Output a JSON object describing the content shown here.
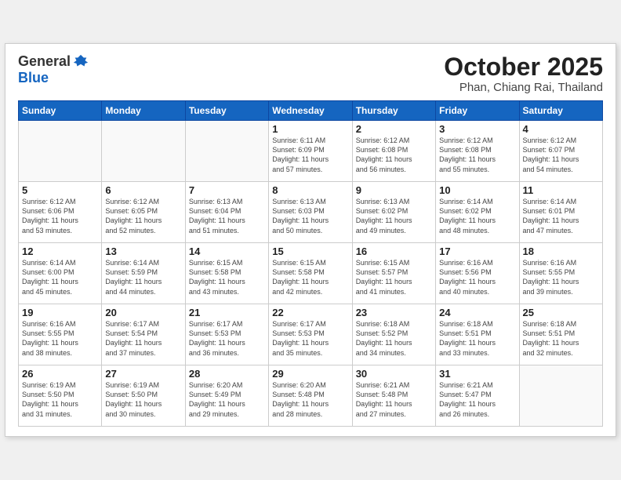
{
  "header": {
    "logo_line1": "General",
    "logo_line2": "Blue",
    "month": "October 2025",
    "location": "Phan, Chiang Rai, Thailand"
  },
  "days_of_week": [
    "Sunday",
    "Monday",
    "Tuesday",
    "Wednesday",
    "Thursday",
    "Friday",
    "Saturday"
  ],
  "weeks": [
    [
      {
        "day": "",
        "info": ""
      },
      {
        "day": "",
        "info": ""
      },
      {
        "day": "",
        "info": ""
      },
      {
        "day": "1",
        "info": "Sunrise: 6:11 AM\nSunset: 6:09 PM\nDaylight: 11 hours\nand 57 minutes."
      },
      {
        "day": "2",
        "info": "Sunrise: 6:12 AM\nSunset: 6:08 PM\nDaylight: 11 hours\nand 56 minutes."
      },
      {
        "day": "3",
        "info": "Sunrise: 6:12 AM\nSunset: 6:08 PM\nDaylight: 11 hours\nand 55 minutes."
      },
      {
        "day": "4",
        "info": "Sunrise: 6:12 AM\nSunset: 6:07 PM\nDaylight: 11 hours\nand 54 minutes."
      }
    ],
    [
      {
        "day": "5",
        "info": "Sunrise: 6:12 AM\nSunset: 6:06 PM\nDaylight: 11 hours\nand 53 minutes."
      },
      {
        "day": "6",
        "info": "Sunrise: 6:12 AM\nSunset: 6:05 PM\nDaylight: 11 hours\nand 52 minutes."
      },
      {
        "day": "7",
        "info": "Sunrise: 6:13 AM\nSunset: 6:04 PM\nDaylight: 11 hours\nand 51 minutes."
      },
      {
        "day": "8",
        "info": "Sunrise: 6:13 AM\nSunset: 6:03 PM\nDaylight: 11 hours\nand 50 minutes."
      },
      {
        "day": "9",
        "info": "Sunrise: 6:13 AM\nSunset: 6:02 PM\nDaylight: 11 hours\nand 49 minutes."
      },
      {
        "day": "10",
        "info": "Sunrise: 6:14 AM\nSunset: 6:02 PM\nDaylight: 11 hours\nand 48 minutes."
      },
      {
        "day": "11",
        "info": "Sunrise: 6:14 AM\nSunset: 6:01 PM\nDaylight: 11 hours\nand 47 minutes."
      }
    ],
    [
      {
        "day": "12",
        "info": "Sunrise: 6:14 AM\nSunset: 6:00 PM\nDaylight: 11 hours\nand 45 minutes."
      },
      {
        "day": "13",
        "info": "Sunrise: 6:14 AM\nSunset: 5:59 PM\nDaylight: 11 hours\nand 44 minutes."
      },
      {
        "day": "14",
        "info": "Sunrise: 6:15 AM\nSunset: 5:58 PM\nDaylight: 11 hours\nand 43 minutes."
      },
      {
        "day": "15",
        "info": "Sunrise: 6:15 AM\nSunset: 5:58 PM\nDaylight: 11 hours\nand 42 minutes."
      },
      {
        "day": "16",
        "info": "Sunrise: 6:15 AM\nSunset: 5:57 PM\nDaylight: 11 hours\nand 41 minutes."
      },
      {
        "day": "17",
        "info": "Sunrise: 6:16 AM\nSunset: 5:56 PM\nDaylight: 11 hours\nand 40 minutes."
      },
      {
        "day": "18",
        "info": "Sunrise: 6:16 AM\nSunset: 5:55 PM\nDaylight: 11 hours\nand 39 minutes."
      }
    ],
    [
      {
        "day": "19",
        "info": "Sunrise: 6:16 AM\nSunset: 5:55 PM\nDaylight: 11 hours\nand 38 minutes."
      },
      {
        "day": "20",
        "info": "Sunrise: 6:17 AM\nSunset: 5:54 PM\nDaylight: 11 hours\nand 37 minutes."
      },
      {
        "day": "21",
        "info": "Sunrise: 6:17 AM\nSunset: 5:53 PM\nDaylight: 11 hours\nand 36 minutes."
      },
      {
        "day": "22",
        "info": "Sunrise: 6:17 AM\nSunset: 5:53 PM\nDaylight: 11 hours\nand 35 minutes."
      },
      {
        "day": "23",
        "info": "Sunrise: 6:18 AM\nSunset: 5:52 PM\nDaylight: 11 hours\nand 34 minutes."
      },
      {
        "day": "24",
        "info": "Sunrise: 6:18 AM\nSunset: 5:51 PM\nDaylight: 11 hours\nand 33 minutes."
      },
      {
        "day": "25",
        "info": "Sunrise: 6:18 AM\nSunset: 5:51 PM\nDaylight: 11 hours\nand 32 minutes."
      }
    ],
    [
      {
        "day": "26",
        "info": "Sunrise: 6:19 AM\nSunset: 5:50 PM\nDaylight: 11 hours\nand 31 minutes."
      },
      {
        "day": "27",
        "info": "Sunrise: 6:19 AM\nSunset: 5:50 PM\nDaylight: 11 hours\nand 30 minutes."
      },
      {
        "day": "28",
        "info": "Sunrise: 6:20 AM\nSunset: 5:49 PM\nDaylight: 11 hours\nand 29 minutes."
      },
      {
        "day": "29",
        "info": "Sunrise: 6:20 AM\nSunset: 5:48 PM\nDaylight: 11 hours\nand 28 minutes."
      },
      {
        "day": "30",
        "info": "Sunrise: 6:21 AM\nSunset: 5:48 PM\nDaylight: 11 hours\nand 27 minutes."
      },
      {
        "day": "31",
        "info": "Sunrise: 6:21 AM\nSunset: 5:47 PM\nDaylight: 11 hours\nand 26 minutes."
      },
      {
        "day": "",
        "info": ""
      }
    ]
  ]
}
